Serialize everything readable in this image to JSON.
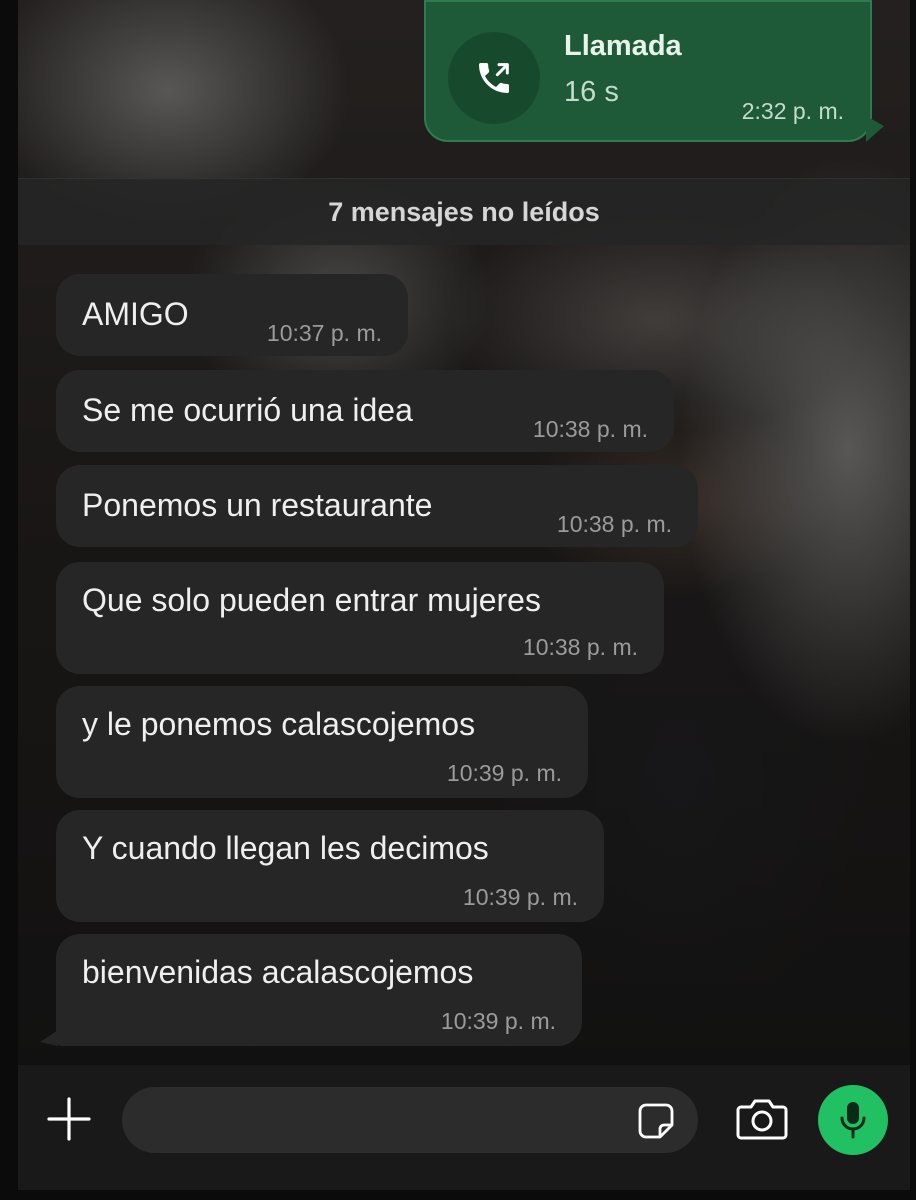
{
  "call": {
    "title": "Llamada",
    "duration": "16 s",
    "time": "2:32 p. m.",
    "icon": "outgoing-call-icon",
    "bubble_color": "#1e5a37"
  },
  "unread_banner": {
    "text": "7 mensajes no leídos"
  },
  "messages": [
    {
      "text": "AMIGO",
      "time": "10:37 p. m."
    },
    {
      "text": "Se me ocurrió una idea",
      "time": "10:38 p. m."
    },
    {
      "text": "Ponemos un restaurante",
      "time": "10:38 p. m."
    },
    {
      "text": "Que solo pueden entrar mujeres",
      "time": "10:38 p. m."
    },
    {
      "text": "y le ponemos calascojemos",
      "time": "10:39 p. m."
    },
    {
      "text": "Y cuando llegan les decimos",
      "time": "10:39 p. m."
    },
    {
      "text": "bienvenidas acalascojemos",
      "time": "10:39 p. m."
    }
  ],
  "composer": {
    "plus_icon": "plus-icon",
    "sticker_icon": "sticker-icon",
    "camera_icon": "camera-icon",
    "mic_icon": "microphone-icon",
    "mic_color": "#21c063"
  }
}
